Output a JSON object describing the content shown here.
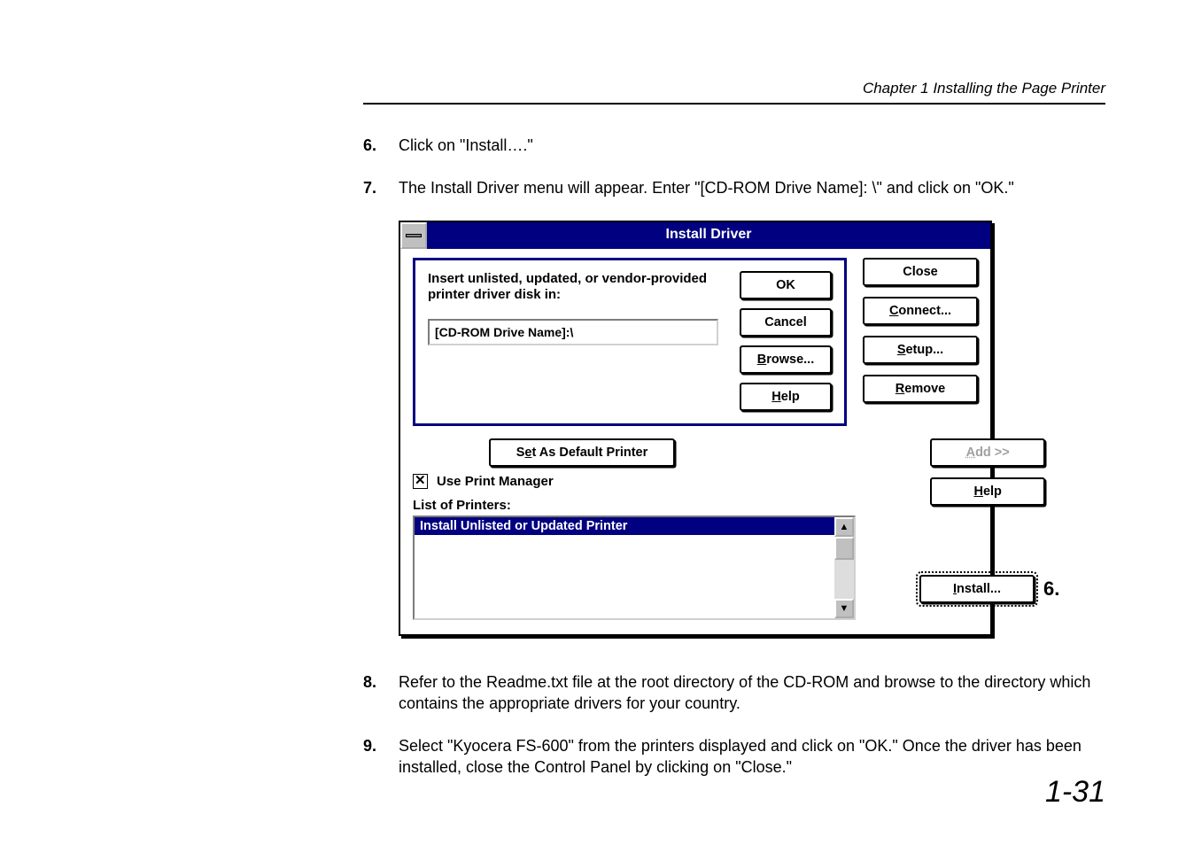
{
  "header": {
    "chapter": "Chapter 1  Installing the Page Printer"
  },
  "steps": {
    "s6": {
      "num": "6.",
      "text": "Click on \"Install….\""
    },
    "s7": {
      "num": "7.",
      "text": "The Install Driver menu will appear.  Enter \"[CD-ROM Drive Name]: \\\" and click on \"OK.\""
    },
    "s8": {
      "num": "8.",
      "text": "Refer to the Readme.txt file at the root directory of the CD-ROM and browse to the directory which contains the appropriate drivers for your country."
    },
    "s9": {
      "num": "9.",
      "text": "Select \"Kyocera FS-600\" from the printers displayed and click on \"OK.\" Once the driver has been installed, close the Control Panel by clicking on \"Close.\""
    }
  },
  "dialog": {
    "title": "Install Driver",
    "insert_label": "Insert unlisted, updated, or vendor-provided printer driver disk in:",
    "path_value": "[CD-ROM Drive Name]:\\",
    "ok": "OK",
    "cancel": "Cancel",
    "browse": "Browse...",
    "browse_u": "B",
    "help": "Help",
    "help_u": "H",
    "set_default": "Set As Default Printer",
    "set_default_u": "e",
    "use_pm": "Use Print Manager",
    "use_pm_u": "U",
    "list_label": "List of Printers:",
    "list_label_u": "L",
    "list_item": "Install Unlisted or Updated Printer"
  },
  "side": {
    "close": "Close",
    "connect": "Connect...",
    "connect_u": "C",
    "setup": "Setup...",
    "setup_u": "S",
    "remove": "Remove",
    "remove_u": "R",
    "add": "Add >>",
    "add_u": "A",
    "help": "Help",
    "help_u": "H",
    "install": "Install...",
    "install_u": "I"
  },
  "callout": {
    "six": "6."
  },
  "page_number": "1-31"
}
